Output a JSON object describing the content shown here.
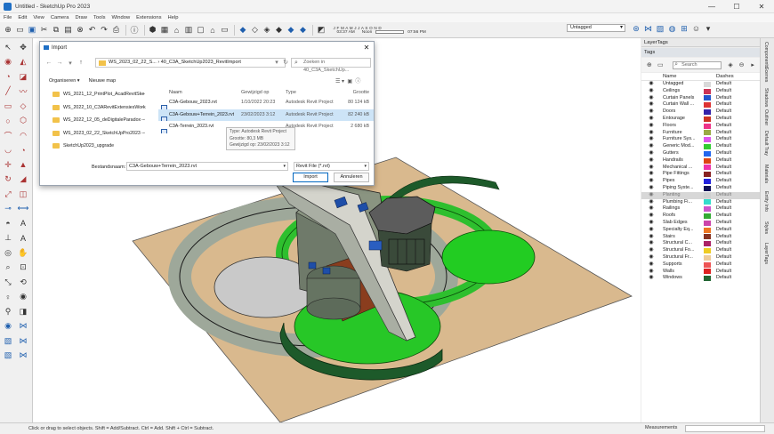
{
  "window": {
    "title": "Untitled - SketchUp Pro 2023",
    "controls": [
      "—",
      "☐",
      "✕"
    ]
  },
  "menu": [
    "File",
    "Edit",
    "View",
    "Camera",
    "Draw",
    "Tools",
    "Window",
    "Extensions",
    "Help"
  ],
  "shadow": {
    "months": "J F M A M J J A S O N D",
    "time_start": "03:37 AM",
    "time_mid": "Noon",
    "time_end": "07:56 PM"
  },
  "tag_select": "Untagged",
  "status": {
    "hint": "Click or drag to select objects. Shift = Add/Subtract. Ctrl = Add. Shift + Ctrl = Subtract.",
    "measurements_label": "Measurements"
  },
  "tray": {
    "title": "LayerTags",
    "tags_header": "Tags",
    "search_placeholder": "Search",
    "columns": {
      "name": "Name",
      "dashes": "Dashes"
    },
    "tags": [
      {
        "name": "Untagged",
        "color": "#d9d9d9",
        "dashes": "Default"
      },
      {
        "name": "Ceilings",
        "color": "#cc3355",
        "dashes": "Default"
      },
      {
        "name": "Curtain Panels",
        "color": "#2255cc",
        "dashes": "Default"
      },
      {
        "name": "Curtain Wall ...",
        "color": "#dd3333",
        "dashes": "Default"
      },
      {
        "name": "Doors",
        "color": "#3322aa",
        "dashes": "Default"
      },
      {
        "name": "Entourage",
        "color": "#cc3322",
        "dashes": "Default"
      },
      {
        "name": "Floors",
        "color": "#ee3388",
        "dashes": "Default"
      },
      {
        "name": "Furniture",
        "color": "#99aa44",
        "dashes": "Default"
      },
      {
        "name": "Furniture Sys...",
        "color": "#dd55ee",
        "dashes": "Default"
      },
      {
        "name": "Generic Mod...",
        "color": "#33cc33",
        "dashes": "Default"
      },
      {
        "name": "Gutters",
        "color": "#2266ee",
        "dashes": "Default"
      },
      {
        "name": "Handrails",
        "color": "#dd4411",
        "dashes": "Default"
      },
      {
        "name": "Mechanical ...",
        "color": "#ee33aa",
        "dashes": "Default"
      },
      {
        "name": "Pipe Fittings",
        "color": "#882222",
        "dashes": "Default"
      },
      {
        "name": "Pipes",
        "color": "#2222dd",
        "dashes": "Default"
      },
      {
        "name": "Piping Syste...",
        "color": "#111155",
        "dashes": "Default"
      },
      {
        "name": "Planting",
        "color": "#cfcfcf",
        "dashes": "Default"
      },
      {
        "name": "Plumbing Fi...",
        "color": "#33ddcc",
        "dashes": "Default"
      },
      {
        "name": "Railings",
        "color": "#cc55cc",
        "dashes": "Default"
      },
      {
        "name": "Roofs",
        "color": "#33aa33",
        "dashes": "Default"
      },
      {
        "name": "Slab Edges",
        "color": "#cc44aa",
        "dashes": "Default"
      },
      {
        "name": "Specialty Eq...",
        "color": "#ee7722",
        "dashes": "Default"
      },
      {
        "name": "Stairs",
        "color": "#883322",
        "dashes": "Default"
      },
      {
        "name": "Structural C...",
        "color": "#aa2266",
        "dashes": "Default"
      },
      {
        "name": "Structural Fo...",
        "color": "#eecc22",
        "dashes": "Default"
      },
      {
        "name": "Structural Fr...",
        "color": "#eecc99",
        "dashes": "Default"
      },
      {
        "name": "Supports",
        "color": "#ee5555",
        "dashes": "Default"
      },
      {
        "name": "Walls",
        "color": "#dd2222",
        "dashes": "Default"
      },
      {
        "name": "Windows",
        "color": "#226633",
        "dashes": "Default"
      }
    ]
  },
  "side_tabs": [
    "Components",
    "Scenes",
    "Shadows",
    "Outliner",
    "Default Tray",
    "Materials",
    "Entity Info",
    "Styles",
    "LayerTags"
  ],
  "dialog": {
    "title": "Import",
    "path": "WS_2023_02_22_S...  ›  40_C3A_SketchUp2023_RevitImport",
    "search_placeholder": "Zoeken in 40_C3A_SketchUp...",
    "organize": "Organiseren ▾",
    "new_folder": "Nieuwe map",
    "sidebar": [
      "WS_2021_12_PrintPlot_AcadRevitSke",
      "WS_2022_10_C3ARevitExtensiesWork",
      "WS_2022_12_05_deDigitaleParadox",
      "WS_2023_02_22_SketchUpPro2023",
      "SketchUp2023_upgrade"
    ],
    "columns": {
      "name": "Naam",
      "date": "Gewijzigd op",
      "type": "Type",
      "size": "Grootte"
    },
    "files": [
      {
        "name": "C3A-Gebouw_2023.rvt",
        "date": "1/10/2022 20:23",
        "type": "Autodesk Revit Project",
        "size": "80 124 kB"
      },
      {
        "name": "C3A-Gebouw+Terrein_2023.rvt",
        "date": "23/02/2023 3:12",
        "type": "Autodesk Revit Project",
        "size": "82 240 kB"
      },
      {
        "name": "C3A-Terrein_2023.rvt",
        "date": "",
        "type": "Autodesk Revit Project",
        "size": "2 680 kB"
      }
    ],
    "tooltip": [
      "Type: Autodesk Revit Project",
      "Grootte: 80,3 MB",
      "Gewijzigd op: 23/02/2023 3:12"
    ],
    "filename_label": "Bestandsnaam:",
    "filename_value": "C3A-Gebouw+Terrein_2023.rvt",
    "filetype": "Revit File (*.rvt)",
    "open_button": "Import",
    "cancel_button": "Annuleren"
  }
}
